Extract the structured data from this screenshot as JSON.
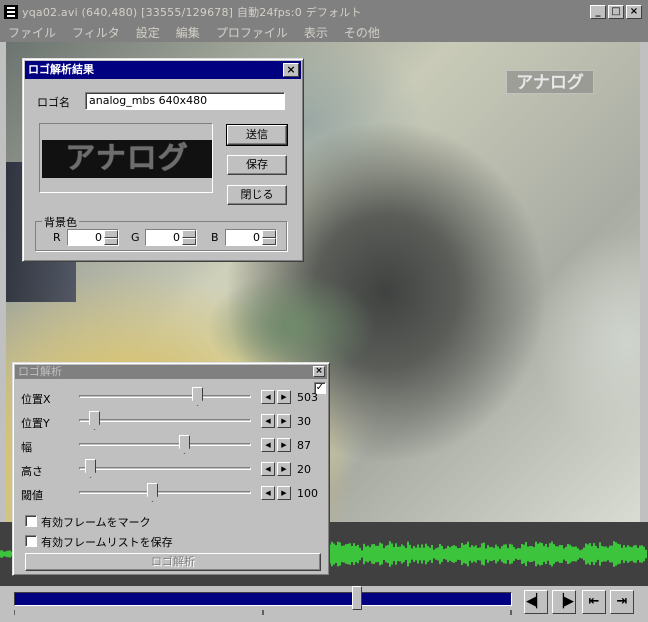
{
  "window": {
    "title": "yqa02.avi (640,480)  [33555/129678]  自動24fps:0  デフォルト",
    "minimize": "_",
    "maximize": "□",
    "close": "×"
  },
  "menu": [
    "ファイル",
    "フィルタ",
    "設定",
    "編集",
    "プロファイル",
    "表示",
    "その他"
  ],
  "video": {
    "watermark": "アナログ"
  },
  "result_dialog": {
    "title": "ロゴ解析結果",
    "logo_name_label": "ロゴ名",
    "logo_name_value": "analog_mbs 640x480",
    "preview_text": "アナログ",
    "send_button": "送信",
    "save_button": "保存",
    "close_button": "閉じる",
    "bg_group": "背景色",
    "r_label": "R",
    "g_label": "G",
    "b_label": "B",
    "r_value": "0",
    "g_value": "0",
    "b_value": "0"
  },
  "analysis_panel": {
    "title": "ロゴ解析",
    "checked_mark": "✓",
    "left_arrow": "◀",
    "right_arrow": "▶",
    "sliders": [
      {
        "label": "位置X",
        "value": "503",
        "level": 0.7
      },
      {
        "label": "位置Y",
        "value": "30",
        "level": 0.06
      },
      {
        "label": "幅",
        "value": "87",
        "level": 0.62
      },
      {
        "label": "高さ",
        "value": "20",
        "level": 0.04
      },
      {
        "label": "閾値",
        "value": "100",
        "level": 0.42
      }
    ],
    "check_mark_frames": "有効フレームをマーク",
    "check_save_list": "有効フレームリストを保存",
    "analyze_button": "ロゴ解析"
  },
  "transport": {
    "seek_level": 0.688,
    "prev_frame": "◀▏",
    "next_frame": "▕▶",
    "prev_key": "⇤",
    "next_key": "⇥"
  }
}
